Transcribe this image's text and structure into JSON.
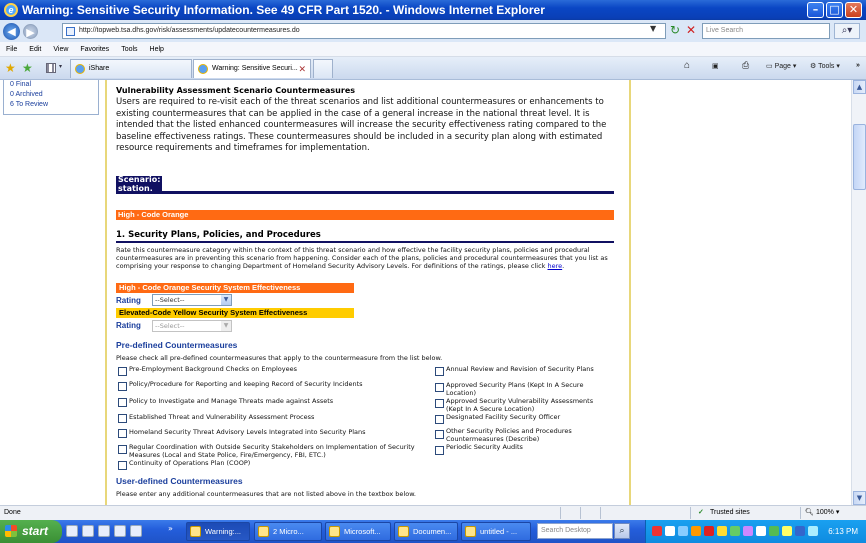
{
  "window": {
    "title": "Warning: Sensitive Security Information. See 49 CFR Part 1520. - Windows Internet Explorer"
  },
  "addressbar": {
    "url": "http://topweb.tsa.dhs.gov/risk/assessments/updatecountermeasures.do",
    "search_placeholder": "Live Search"
  },
  "menubar": {
    "items": [
      "File",
      "Edit",
      "View",
      "Favorites",
      "Tools",
      "Help"
    ]
  },
  "tabs": [
    {
      "label": "iShare",
      "active": false
    },
    {
      "label": "Warning: Sensitive Securi...",
      "active": true
    }
  ],
  "toolbar_right": {
    "page_label": "Page",
    "tools_label": "Tools"
  },
  "leftnav": {
    "items": [
      "0 Final",
      "0 Archived",
      "6 To Review"
    ]
  },
  "main": {
    "title": "Vulnerability Assessment Scenario Countermeasures",
    "intro": "Users are required to re-visit each of the threat scenarios and list additional countermeasures or enhancements to existing countermeasures that can be applied in the case of a general increase in the national threat level. It is intended that the listed enhanced countermeasures will increase the security effectiveness rating compared to the baseline effectiveness ratings. These countermeasures should be included in a security plan along with estimated resource requirements and timeframes for implementation.",
    "scenario_label": "Scenario:",
    "scenario_value": "station.",
    "threat_level": "High - Code Orange",
    "section_title": "1.    Security Plans, Policies, and Procedures",
    "section_desc": "Rate this countermeasure category within the context of this threat scenario and how effective the facility security plans, policies and procedural countermeasures are in preventing this scenario from happening. Consider each of the plans, policies and procedural countermeasures that you list as comprising your response to changing Department of Homeland Security Advisory Levels. For definitions of the ratings, please click",
    "section_link": "here",
    "high_eff_label": "High - Code Orange Security System Effectiveness",
    "yellow_eff_label": "Elevated-Code Yellow Security System Effectiveness",
    "rating_label": "Rating",
    "select_placeholder": "--Select--",
    "predefined_title": "Pre-defined Countermeasures",
    "predefined_sub": "Please check all pre-defined countermeasures that apply to the countermeasure from the list below.",
    "left_checks": [
      "Pre-Employment Background Checks on Employees",
      "Policy/Procedure for Reporting and keeping Record of Security Incidents",
      "Policy to Investigate and Manage Threats made against Assets",
      "Established Threat and Vulnerability Assessment Process",
      "Homeland Security Threat Advisory Levels Integrated into Security Plans",
      "Regular Coordination with Outside Security Stakeholders on Implementation of Security Measures (Local and State Police, Fire/Emergency, FBI, ETC.)",
      "Continuity of Operations Plan (COOP)"
    ],
    "right_checks": [
      "Annual Review and Revision of Security Plans",
      "Approved Security Plans (Kept In A Secure Location)",
      "Approved Security Vulnerability Assessments (Kept In A Secure Location)",
      "Designated Facility Security Officer",
      "Other Security Policies and Procedures Countermeasures (Describe)",
      "Periodic Security Audits"
    ],
    "userdefined_title": "User-defined Countermeasures",
    "userdefined_sub": "Please enter any additional countermeasures that are not listed above in the textbox below."
  },
  "statusbar": {
    "status": "Done",
    "zone": "Trusted sites",
    "zoom": "100%"
  },
  "taskbar": {
    "start_label": "start",
    "items": [
      {
        "label": "Warning:...",
        "active": true
      },
      {
        "label": "2 Micro...",
        "active": false
      },
      {
        "label": "Microsoft...",
        "active": false
      },
      {
        "label": "Documen...",
        "active": false
      },
      {
        "label": "untitled - ...",
        "active": false
      }
    ],
    "desktop_search_placeholder": "Search Desktop",
    "clock": "6:13 PM"
  }
}
